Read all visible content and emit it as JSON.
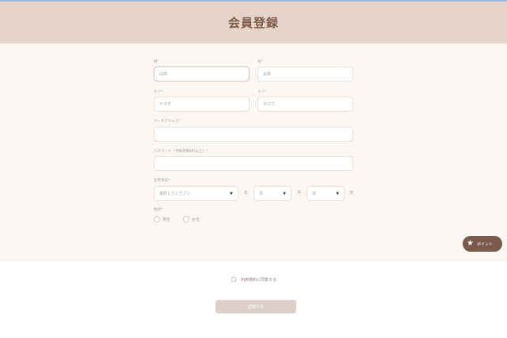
{
  "header": {
    "title": "会員登録"
  },
  "form": {
    "sei": {
      "label": "姓*",
      "value": "山田"
    },
    "mei": {
      "label": "名*",
      "value": "太郎"
    },
    "sei_kana": {
      "label": "セイ*",
      "value": "ヤマダ"
    },
    "mei_kana": {
      "label": "メイ*",
      "value": "タロウ"
    },
    "email": {
      "label": "メールアドレス*",
      "value": ""
    },
    "password": {
      "label": "パスワード（半角英数8桁以上）*",
      "value": ""
    },
    "birthdate": {
      "label": "生年月日*",
      "year_value": "選択してください",
      "year_unit": "年",
      "month_value": "月",
      "month_unit": "月",
      "day_value": "日",
      "day_unit": "日"
    },
    "gender": {
      "label": "性別*",
      "options": [
        "男性",
        "女性"
      ]
    }
  },
  "point_button": {
    "label": "ポイント",
    "icon": "star-icon"
  },
  "agreement": {
    "label": "利用規約に同意する",
    "checked": false
  },
  "submit": {
    "label": "登録する"
  },
  "colors": {
    "header_bg": "#e6d4ca",
    "title": "#7b5a48",
    "form_bg": "#fdf7f3",
    "point_button": "#7a5a4c",
    "submit_bg": "#ddd0c9"
  }
}
